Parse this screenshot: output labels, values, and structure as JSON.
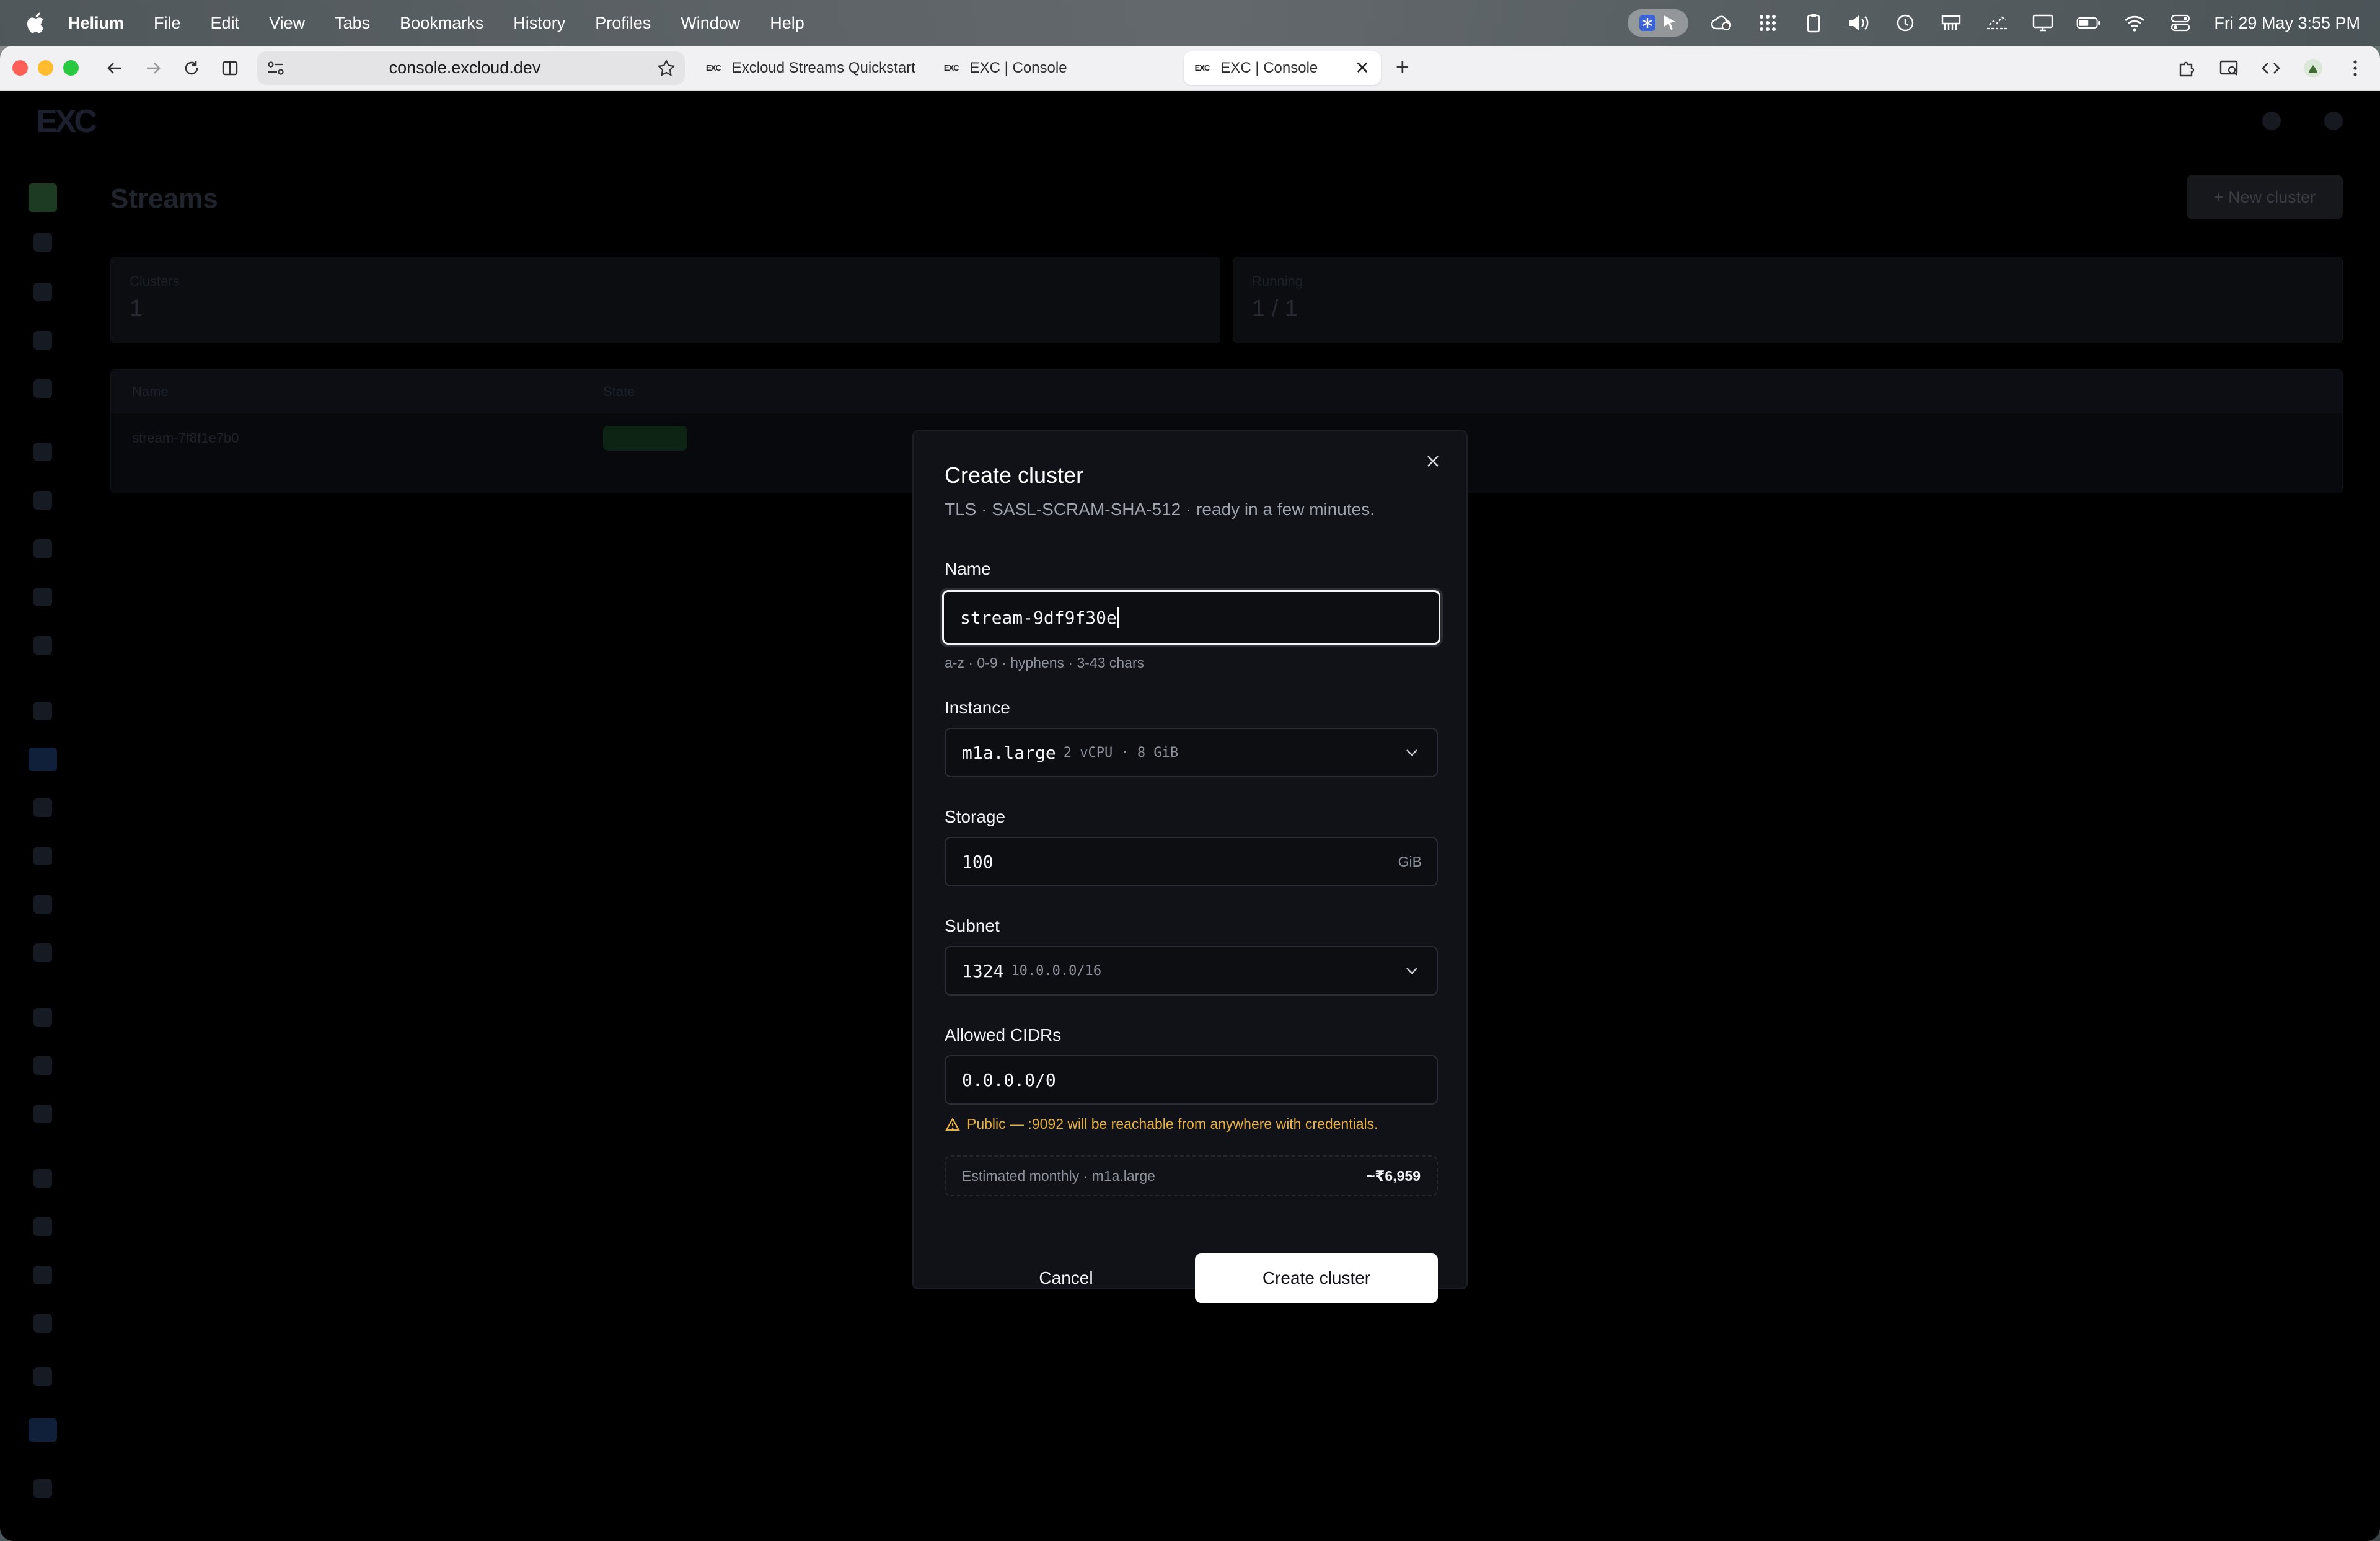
{
  "menubar": {
    "app_name": "Helium",
    "items": [
      "File",
      "Edit",
      "View",
      "Tabs",
      "Bookmarks",
      "History",
      "Profiles",
      "Window",
      "Help"
    ],
    "clock": "Fri 29 May  3:55 PM"
  },
  "browser": {
    "url": "console.excloud.dev",
    "tabs": [
      {
        "favicon": "EXC",
        "title": "Excloud Streams Quickstart"
      },
      {
        "favicon": "EXC",
        "title": "EXC | Console"
      },
      {
        "favicon": "EXC",
        "title": "EXC | Console"
      }
    ]
  },
  "modal": {
    "title": "Create cluster",
    "subtitle": "TLS · SASL-SCRAM-SHA-512 · ready in a few minutes.",
    "name": {
      "label": "Name",
      "value": "stream-9df9f30e",
      "hint": "a-z · 0-9 · hyphens · 3-43 chars"
    },
    "instance": {
      "label": "Instance",
      "value": "m1a.large",
      "detail": "2 vCPU · 8 GiB"
    },
    "storage": {
      "label": "Storage",
      "value": "100",
      "unit": "GiB"
    },
    "subnet": {
      "label": "Subnet",
      "value": "1324",
      "detail": "10.0.0.0/16"
    },
    "cidrs": {
      "label": "Allowed CIDRs",
      "value": "0.0.0.0/0",
      "warning": "Public — :9092 will be reachable from anywhere with credentials."
    },
    "estimate": {
      "label": "Estimated monthly · m1a.large",
      "value": "~₹6,959"
    },
    "cancel_label": "Cancel",
    "create_label": "Create cluster"
  }
}
